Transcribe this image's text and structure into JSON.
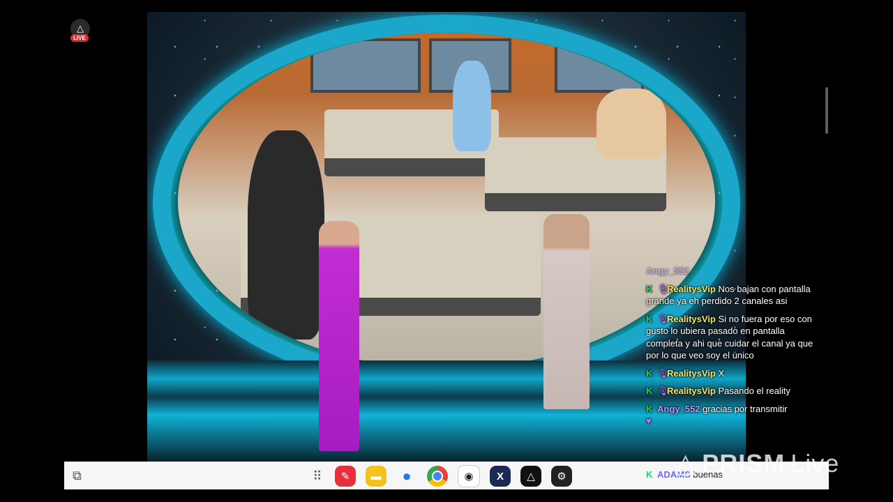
{
  "live": {
    "badge_label": "LIVE"
  },
  "chat": {
    "messages": [
      {
        "user": "Angy_552",
        "text": "",
        "style": "name2",
        "badge": "",
        "faded": true
      },
      {
        "user": "RealitysVip",
        "text": "Nos bajan con pantalla grande ya eh perdido 2 canales asi",
        "style": "name",
        "badge": "K"
      },
      {
        "user": "RealitysVip",
        "text": "Si  no fuera por eso con gusto lo ubiera pasado en pantalla completa y ahi que cuidar el canal ya que por lo que veo soy el único",
        "style": "name",
        "badge": "K"
      },
      {
        "user": "RealitysVip",
        "text": "X",
        "style": "name",
        "badge": "K"
      },
      {
        "user": "RealitysVip",
        "text": "Pasando el reality",
        "style": "name",
        "badge": "K"
      },
      {
        "user": "Angy_552",
        "text": "gracias por transmitir",
        "style": "name2",
        "badge": "K"
      }
    ],
    "last_message": {
      "user": "ADAMS",
      "text": "buenas"
    }
  },
  "watermark": {
    "brand": "PRISM",
    "suffix": "Live"
  },
  "taskbar": {
    "apps": [
      {
        "name": "app-drawer-icon",
        "glyph": "⋮⋮",
        "color": ""
      },
      {
        "name": "notes-app-icon",
        "glyph": "✎",
        "color": "#e8303c"
      },
      {
        "name": "folder-app-icon",
        "glyph": "▭",
        "color": "#f4c21f"
      },
      {
        "name": "messages-app-icon",
        "glyph": "💬",
        "color": "#1f7ae8"
      },
      {
        "name": "chrome-app-icon",
        "glyph": "◉",
        "color": "#e8e8e8"
      },
      {
        "name": "camera-app-icon",
        "glyph": "◎",
        "color": "#ffffff"
      },
      {
        "name": "xlinker-app-icon",
        "glyph": "X",
        "color": "#1a2a55"
      },
      {
        "name": "prism-app-icon",
        "glyph": "△",
        "color": "#111111"
      },
      {
        "name": "settings-app-icon",
        "glyph": "⚙",
        "color": "#222222"
      }
    ]
  }
}
